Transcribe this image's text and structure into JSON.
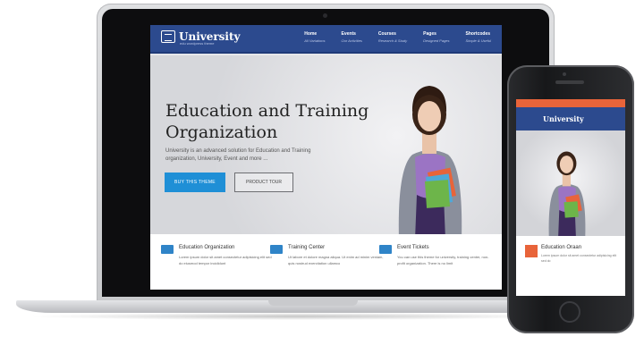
{
  "site": {
    "logo": "University",
    "logo_sub": "edu wordpress theme",
    "nav": [
      {
        "title": "Home",
        "sub": "All Variations"
      },
      {
        "title": "Events",
        "sub": "Our Activities"
      },
      {
        "title": "Courses",
        "sub": "Research & Study"
      },
      {
        "title": "Pages",
        "sub": "Designed Pages"
      },
      {
        "title": "Shortcodes",
        "sub": "Simple & Useful"
      }
    ]
  },
  "hero": {
    "title": "Education and Training Organization",
    "description": "University is an advanced solution for Education and Training organization, University, Event and more ...",
    "buy_label": "BUY THIS THEME",
    "tour_label": "PRODUCT TOUR"
  },
  "features": [
    {
      "title": "Education Organization",
      "text": "Lorem ipsum dolor sit amet consectetur adipisicing elit sed do eiusmod tempor incididunt"
    },
    {
      "title": "Training Center",
      "text": "Ut labore et dolore magna aliqua. Ut enim ad minim veniam, quis nostrud exercitation ullamco"
    },
    {
      "title": "Event Tickets",
      "text": "You can use this theme for university, training center, non-profit organization. There is no limit"
    }
  ],
  "phone": {
    "logo": "University",
    "feature_title": "Education Oraan",
    "feature_text": "Lorem ipsum dolor sit amet consectetur adipisicing elit sed do"
  },
  "colors": {
    "nav_blue": "#2c4a8e",
    "accent_blue": "#1f8fd6",
    "accent_orange": "#e8643a"
  }
}
